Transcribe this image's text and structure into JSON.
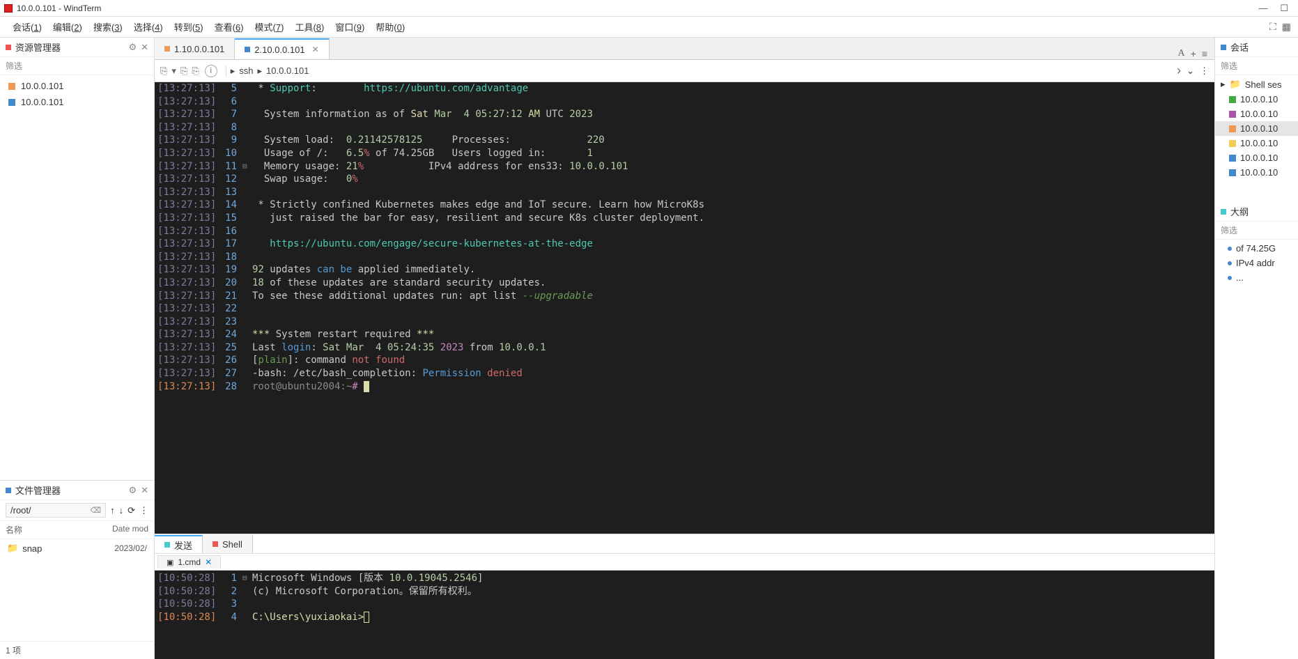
{
  "title": "10.0.0.101 - WindTerm",
  "menubar": {
    "items": [
      {
        "label": "会话(",
        "key": "1",
        "tail": ")"
      },
      {
        "label": "编辑(",
        "key": "2",
        "tail": ")"
      },
      {
        "label": "搜索(",
        "key": "3",
        "tail": ")"
      },
      {
        "label": "选择(",
        "key": "4",
        "tail": ")"
      },
      {
        "label": "转到(",
        "key": "5",
        "tail": ")"
      },
      {
        "label": "查看(",
        "key": "6",
        "tail": ")"
      },
      {
        "label": "模式(",
        "key": "7",
        "tail": ")"
      },
      {
        "label": "工具(",
        "key": "8",
        "tail": ")"
      },
      {
        "label": "窗口(",
        "key": "9",
        "tail": ")"
      },
      {
        "label": "帮助(",
        "key": "0",
        "tail": ")"
      }
    ]
  },
  "left_panel": {
    "resource_title": "资源管理器",
    "filter_label": "筛选",
    "resources": [
      {
        "color": "orange",
        "label": "10.0.0.101"
      },
      {
        "color": "blue",
        "label": "10.0.0.101"
      }
    ],
    "file_title": "文件管理器",
    "path": "/root/",
    "file_header_name": "名称",
    "file_header_date": "Date mod",
    "files": [
      {
        "name": "snap",
        "date": "2023/02/"
      }
    ],
    "items_count": "1 项"
  },
  "tabs": [
    {
      "color": "orange",
      "label": "1.10.0.0.101",
      "active": false
    },
    {
      "color": "blue",
      "label": "2.10.0.0.101",
      "active": true
    }
  ],
  "address": {
    "protocol": "ssh",
    "host": "10.0.0.101"
  },
  "terminal_lines": [
    {
      "ts": "[13:27:13]",
      "ln": "5",
      "spans": [
        {
          "t": " * ",
          "c": ""
        },
        {
          "t": "Support",
          "c": "c-cyan"
        },
        {
          "t": ":        ",
          "c": ""
        },
        {
          "t": "https://ubuntu.com/advantage",
          "c": "c-url"
        }
      ]
    },
    {
      "ts": "[13:27:13]",
      "ln": "6",
      "spans": []
    },
    {
      "ts": "[13:27:13]",
      "ln": "7",
      "spans": [
        {
          "t": "  System information as of ",
          "c": ""
        },
        {
          "t": "Sat",
          "c": "c-yellow"
        },
        {
          "t": " ",
          "c": ""
        },
        {
          "t": "Mar  4 05:27:12",
          "c": "c-num"
        },
        {
          "t": " ",
          "c": ""
        },
        {
          "t": "AM",
          "c": "c-yellow"
        },
        {
          "t": " UTC ",
          "c": ""
        },
        {
          "t": "2023",
          "c": "c-num"
        }
      ]
    },
    {
      "ts": "[13:27:13]",
      "ln": "8",
      "spans": []
    },
    {
      "ts": "[13:27:13]",
      "ln": "9",
      "spans": [
        {
          "t": "  System load:  ",
          "c": ""
        },
        {
          "t": "0.21142578125",
          "c": "c-num"
        },
        {
          "t": "     Processes:             ",
          "c": ""
        },
        {
          "t": "220",
          "c": "c-num"
        }
      ]
    },
    {
      "ts": "[13:27:13]",
      "ln": "10",
      "spans": [
        {
          "t": "  Usage of /:   ",
          "c": ""
        },
        {
          "t": "6.5",
          "c": "c-num"
        },
        {
          "t": "%",
          "c": "c-red"
        },
        {
          "t": " of 74.25GB   Users logged in:       ",
          "c": ""
        },
        {
          "t": "1",
          "c": "c-num"
        }
      ]
    },
    {
      "ts": "[13:27:13]",
      "ln": "11",
      "gutter": "⊟",
      "spans": [
        {
          "t": "  Memory usage: ",
          "c": ""
        },
        {
          "t": "21",
          "c": "c-num"
        },
        {
          "t": "%",
          "c": "c-red"
        },
        {
          "t": "           IPv4 address for ens33: ",
          "c": ""
        },
        {
          "t": "10.0.0.101",
          "c": "c-num"
        }
      ]
    },
    {
      "ts": "[13:27:13]",
      "ln": "12",
      "spans": [
        {
          "t": "  Swap usage:   ",
          "c": ""
        },
        {
          "t": "0",
          "c": "c-num"
        },
        {
          "t": "%",
          "c": "c-red"
        }
      ]
    },
    {
      "ts": "[13:27:13]",
      "ln": "13",
      "spans": []
    },
    {
      "ts": "[13:27:13]",
      "ln": "14",
      "spans": [
        {
          "t": " * Strictly confined Kubernetes makes edge and IoT secure. Learn how MicroK8s",
          "c": ""
        }
      ]
    },
    {
      "ts": "[13:27:13]",
      "ln": "15",
      "spans": [
        {
          "t": "   just raised the bar for easy, resilient and secure K8s cluster deployment.",
          "c": ""
        }
      ]
    },
    {
      "ts": "[13:27:13]",
      "ln": "16",
      "spans": []
    },
    {
      "ts": "[13:27:13]",
      "ln": "17",
      "spans": [
        {
          "t": "   ",
          "c": ""
        },
        {
          "t": "https://ubuntu.com/engage/secure-kubernetes-at-the-edge",
          "c": "c-url"
        }
      ]
    },
    {
      "ts": "[13:27:13]",
      "ln": "18",
      "spans": []
    },
    {
      "ts": "[13:27:13]",
      "ln": "19",
      "spans": [
        {
          "t": "92",
          "c": "c-num"
        },
        {
          "t": " updates ",
          "c": ""
        },
        {
          "t": "can be",
          "c": "c-blue"
        },
        {
          "t": " applied immediately.",
          "c": ""
        }
      ]
    },
    {
      "ts": "[13:27:13]",
      "ln": "20",
      "spans": [
        {
          "t": "18",
          "c": "c-num"
        },
        {
          "t": " of these updates are standard security updates.",
          "c": ""
        }
      ]
    },
    {
      "ts": "[13:27:13]",
      "ln": "21",
      "spans": [
        {
          "t": "To see these additional updates run: apt list ",
          "c": ""
        },
        {
          "t": "--upgradable",
          "c": "c-comment"
        }
      ]
    },
    {
      "ts": "[13:27:13]",
      "ln": "22",
      "spans": []
    },
    {
      "ts": "[13:27:13]",
      "ln": "23",
      "spans": []
    },
    {
      "ts": "[13:27:13]",
      "ln": "24",
      "spans": [
        {
          "t": "***",
          "c": "c-yellow"
        },
        {
          "t": " System restart required ",
          "c": ""
        },
        {
          "t": "***",
          "c": "c-yellow"
        }
      ]
    },
    {
      "ts": "[13:27:13]",
      "ln": "25",
      "spans": [
        {
          "t": "Last ",
          "c": ""
        },
        {
          "t": "login",
          "c": "c-blue"
        },
        {
          "t": ": ",
          "c": ""
        },
        {
          "t": "Sat Mar  4 05:24:35",
          "c": "c-num"
        },
        {
          "t": " ",
          "c": ""
        },
        {
          "t": "2023",
          "c": "c-purple"
        },
        {
          "t": " from ",
          "c": ""
        },
        {
          "t": "10.0.0.1",
          "c": "c-num"
        }
      ]
    },
    {
      "ts": "[13:27:13]",
      "ln": "26",
      "spans": [
        {
          "t": "[",
          "c": ""
        },
        {
          "t": "plain",
          "c": "c-green"
        },
        {
          "t": "]: command ",
          "c": ""
        },
        {
          "t": "not found",
          "c": "c-red"
        }
      ]
    },
    {
      "ts": "[13:27:13]",
      "ln": "27",
      "spans": [
        {
          "t": "-bash: /etc/bash_completion: ",
          "c": ""
        },
        {
          "t": "Permission",
          "c": "c-blue"
        },
        {
          "t": " ",
          "c": ""
        },
        {
          "t": "denied",
          "c": "c-red"
        }
      ]
    },
    {
      "ts": "[13:27:13]",
      "ln": "28",
      "active": true,
      "spans": [
        {
          "t": "root@ubuntu2004:~",
          "c": "c-prompt"
        },
        {
          "t": "#",
          "c": "c-purple"
        },
        {
          "t": " ",
          "c": ""
        }
      ],
      "cursor": true
    }
  ],
  "right_panel": {
    "sessions_title": "会话",
    "filter_label": "筛选",
    "sessions_folder": "Shell ses",
    "sessions": [
      {
        "color": "green",
        "label": "10.0.0.10"
      },
      {
        "color": "purple",
        "label": "10.0.0.10"
      },
      {
        "color": "orange",
        "label": "10.0.0.10",
        "selected": true
      },
      {
        "color": "yellow",
        "label": "10.0.0.10"
      },
      {
        "color": "blue",
        "label": "10.0.0.10"
      },
      {
        "color": "blue",
        "label": "10.0.0.10"
      }
    ],
    "outline_title": "大纲",
    "outline": [
      {
        "label": "of 74.25G"
      },
      {
        "label": "IPv4 addr"
      },
      {
        "label": "..."
      }
    ]
  },
  "bottom": {
    "tabs": [
      {
        "color": "cyan",
        "label": "发送",
        "active": true
      },
      {
        "color": "red",
        "label": "Shell",
        "active": false
      }
    ],
    "shell_tab": "1.cmd",
    "lines": [
      {
        "ts": "[10:50:28]",
        "ln": "1",
        "gutter": "⊟",
        "spans": [
          {
            "t": "Microsoft Windows [版本 ",
            "c": ""
          },
          {
            "t": "10.0.19045.2546",
            "c": "c-num"
          },
          {
            "t": "]",
            "c": ""
          }
        ]
      },
      {
        "ts": "[10:50:28]",
        "ln": "2",
        "spans": [
          {
            "t": "(c) Microsoft Corporation。保留所有权利。",
            "c": ""
          }
        ]
      },
      {
        "ts": "[10:50:28]",
        "ln": "3",
        "spans": []
      },
      {
        "ts": "[10:50:28]",
        "ln": "4",
        "active": true,
        "spans": [
          {
            "t": "C:\\Users\\yuxiaokai>",
            "c": "c-yellow"
          }
        ],
        "cursor": "hollow"
      }
    ]
  }
}
